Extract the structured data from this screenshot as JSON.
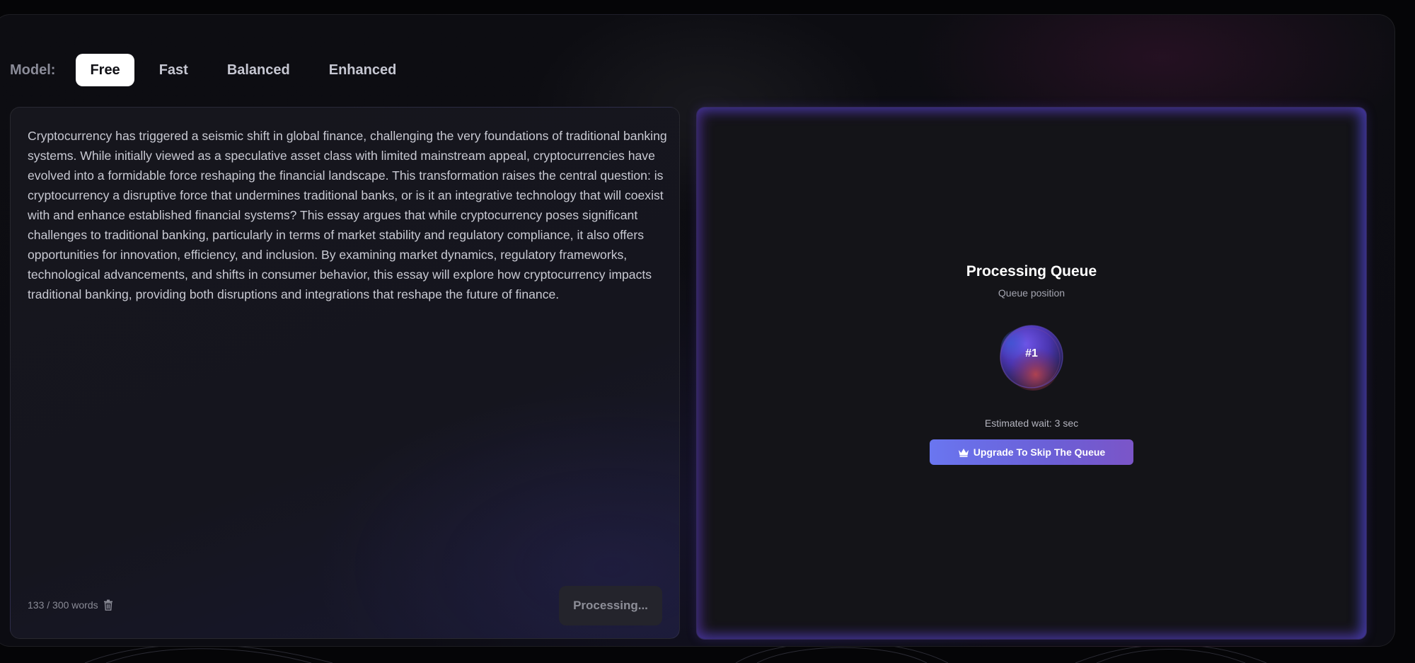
{
  "model_selector": {
    "label": "Model:",
    "tabs": [
      {
        "label": "Free",
        "active": true
      },
      {
        "label": "Fast",
        "active": false
      },
      {
        "label": "Balanced",
        "active": false
      },
      {
        "label": "Enhanced",
        "active": false
      }
    ]
  },
  "editor": {
    "text": "Cryptocurrency has triggered a seismic shift in global finance, challenging the very foundations of traditional banking systems. While initially viewed as a speculative asset class with limited mainstream appeal, cryptocurrencies have evolved into a formidable force reshaping the financial landscape. This transformation raises the central question: is cryptocurrency a disruptive force that undermines traditional banks, or is it an integrative technology that will coexist with and enhance established financial systems? This essay argues that while cryptocurrency poses significant challenges to traditional banking, particularly in terms of market stability and regulatory compliance, it also offers opportunities for innovation, efficiency, and inclusion. By examining market dynamics, regulatory frameworks, technological advancements, and shifts in consumer behavior, this essay will explore how cryptocurrency impacts traditional banking, providing both disruptions and integrations that reshape the future of finance.",
    "word_count": "133 / 300 words",
    "process_button": "Processing..."
  },
  "queue": {
    "title": "Processing Queue",
    "subtitle": "Queue position",
    "position": "#1",
    "estimated_wait": "Estimated wait: 3 sec",
    "upgrade_button": "Upgrade To Skip The Queue",
    "upgrade_icon": "crown-icon"
  },
  "colors": {
    "accent": "#6a76f0",
    "active_tab_bg": "#ffffff",
    "panel_bg": "#141418"
  }
}
